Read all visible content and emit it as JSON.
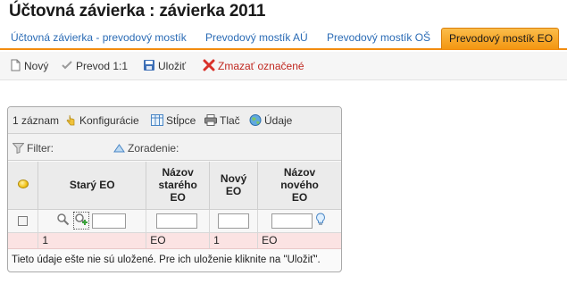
{
  "page": {
    "title": "Účtovná závierka :  závierka 2011"
  },
  "tabs": [
    {
      "label": "Účtovná závierka - prevodový mostík",
      "active": false
    },
    {
      "label": "Prevodový mostík AÚ",
      "active": false
    },
    {
      "label": "Prevodový mostík OŠ",
      "active": false
    },
    {
      "label": "Prevodový mostík EO",
      "active": true
    }
  ],
  "toolbar": {
    "new_label": "Nový",
    "transfer_label": "Prevod 1:1",
    "save_label": "Uložiť",
    "delete_label": "Zmazať označené"
  },
  "grid_toolbar": {
    "record_count": "1 záznam",
    "config_label": "Konfigurácie",
    "columns_label": "Stĺpce",
    "print_label": "Tlač",
    "data_label": "Údaje"
  },
  "filter_bar": {
    "filter_label": "Filter:",
    "sort_label": "Zoradenie:"
  },
  "grid": {
    "headers": [
      "Starý EO",
      "Názov starého EO",
      "Nový EO",
      "Názov nového EO"
    ],
    "rows": [
      {
        "stary_eo": "1",
        "nazov_stareho": "EO",
        "novy_eo": "1",
        "nazov_noveho": "EO"
      }
    ]
  },
  "footer": {
    "message": "Tieto údaje ešte nie sú uložené. Pre ich uloženie kliknite na \"Uložiť\"."
  },
  "colors": {
    "accent": "#f39611",
    "link": "#2a6bb5",
    "danger": "#c0271f",
    "unsaved_row": "#fbe3e3"
  }
}
